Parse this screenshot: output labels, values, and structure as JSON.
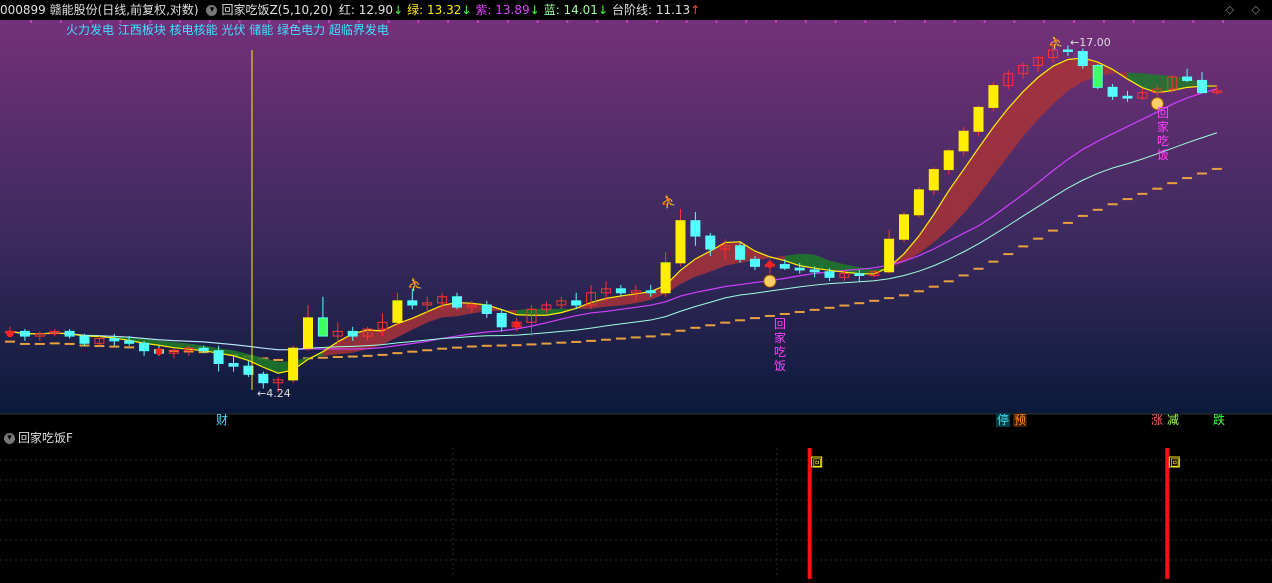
{
  "header": {
    "stock": "000899 赣能股份(日线,前复权,对数)",
    "indicator_name": "回家吃饭Z(5,10,20)",
    "red_label": "红: 12.90",
    "green_label": "绿: 13.32",
    "purple_label": "紫: 13.89",
    "blue_label": "蓝: 14.01",
    "step_label": "台阶线: 11.13",
    "arrow_down": "↓",
    "arrow_up": "↑",
    "icon_left": "chevron-left-icon",
    "icon_right": "chevron-right-icon"
  },
  "colors": {
    "red": "#ff4444",
    "green": "#4cff4c",
    "purple": "#d040ff",
    "blue": "#40e0ff",
    "yellow": "#ffee00",
    "step": "#e8a040",
    "candle_up": "#ff3030",
    "candle_down": "#54ffff"
  },
  "concepts": "火力发电 江西板块 核电核能 光伏 储能 绿色电力 超临界发电",
  "annotations": {
    "high": "17.00",
    "low": "4.24",
    "chars": [
      "回",
      "家",
      "吃",
      "饭"
    ],
    "fin": "财",
    "ting": "停",
    "yu": "预",
    "zhang": "涨",
    "jian": "减",
    "die": "跌"
  },
  "sub": {
    "title": "回家吃饭F",
    "marker": "回"
  },
  "chart_data": {
    "type": "candlestick",
    "scale": "log",
    "high_price": 17.0,
    "low_price": 4.24,
    "ma_values": {
      "红": 12.9,
      "绿": 13.32,
      "紫": 13.89,
      "蓝": 14.01,
      "台阶线": 11.13
    },
    "candles": [
      [
        5.4,
        5.5,
        5.3,
        5.4
      ],
      [
        5.4,
        5.45,
        5.2,
        5.3
      ],
      [
        5.3,
        5.4,
        5.2,
        5.35
      ],
      [
        5.35,
        5.45,
        5.3,
        5.4
      ],
      [
        5.4,
        5.45,
        5.25,
        5.3
      ],
      [
        5.3,
        5.35,
        5.1,
        5.15
      ],
      [
        5.15,
        5.3,
        5.1,
        5.25
      ],
      [
        5.25,
        5.35,
        5.1,
        5.2
      ],
      [
        5.2,
        5.3,
        5.1,
        5.15
      ],
      [
        5.15,
        5.2,
        4.9,
        5.0
      ],
      [
        5.0,
        5.1,
        4.9,
        4.95
      ],
      [
        4.95,
        5.05,
        4.85,
        5.0
      ],
      [
        5.0,
        5.1,
        4.9,
        5.05
      ],
      [
        5.05,
        5.1,
        4.95,
        5.0
      ],
      [
        5.0,
        5.1,
        4.6,
        4.75
      ],
      [
        4.75,
        4.9,
        4.6,
        4.7
      ],
      [
        4.7,
        4.8,
        4.5,
        4.55
      ],
      [
        4.55,
        4.6,
        4.3,
        4.4
      ],
      [
        4.4,
        4.5,
        4.24,
        4.45
      ],
      [
        4.45,
        5.1,
        4.4,
        5.05
      ],
      [
        5.05,
        6.0,
        5.0,
        5.7
      ],
      [
        5.7,
        6.2,
        5.5,
        5.3
      ],
      [
        5.3,
        5.6,
        5.1,
        5.4
      ],
      [
        5.4,
        5.5,
        5.2,
        5.3
      ],
      [
        5.3,
        5.5,
        5.2,
        5.45
      ],
      [
        5.45,
        5.8,
        5.3,
        5.6
      ],
      [
        5.6,
        6.3,
        5.5,
        6.1
      ],
      [
        6.1,
        6.4,
        5.9,
        6.0
      ],
      [
        6.0,
        6.2,
        5.8,
        6.05
      ],
      [
        6.05,
        6.3,
        5.9,
        6.2
      ],
      [
        6.2,
        6.3,
        5.9,
        5.95
      ],
      [
        5.95,
        6.1,
        5.8,
        6.0
      ],
      [
        6.0,
        6.1,
        5.7,
        5.8
      ],
      [
        5.8,
        5.9,
        5.4,
        5.5
      ],
      [
        5.5,
        5.7,
        5.4,
        5.6
      ],
      [
        5.6,
        6.0,
        5.3,
        5.9
      ],
      [
        5.9,
        6.1,
        5.8,
        6.0
      ],
      [
        6.0,
        6.2,
        5.9,
        6.1
      ],
      [
        6.1,
        6.3,
        5.9,
        6.0
      ],
      [
        6.0,
        6.5,
        5.9,
        6.3
      ],
      [
        6.3,
        6.6,
        6.1,
        6.4
      ],
      [
        6.4,
        6.5,
        6.2,
        6.3
      ],
      [
        6.3,
        6.5,
        6.1,
        6.35
      ],
      [
        6.35,
        6.5,
        6.2,
        6.3
      ],
      [
        6.3,
        7.4,
        6.2,
        7.1
      ],
      [
        7.1,
        8.8,
        7.0,
        8.4
      ],
      [
        8.4,
        8.7,
        7.6,
        7.9
      ],
      [
        7.9,
        8.0,
        7.3,
        7.5
      ],
      [
        7.5,
        7.8,
        7.2,
        7.6
      ],
      [
        7.6,
        7.7,
        7.1,
        7.2
      ],
      [
        7.2,
        7.3,
        6.9,
        7.0
      ],
      [
        7.0,
        7.2,
        6.8,
        7.05
      ],
      [
        7.05,
        7.2,
        6.9,
        6.95
      ],
      [
        6.95,
        7.1,
        6.8,
        6.9
      ],
      [
        6.9,
        7.0,
        6.7,
        6.85
      ],
      [
        6.85,
        6.95,
        6.6,
        6.7
      ],
      [
        6.7,
        6.9,
        6.6,
        6.8
      ],
      [
        6.8,
        6.9,
        6.6,
        6.75
      ],
      [
        6.75,
        6.9,
        6.7,
        6.85
      ],
      [
        6.85,
        8.1,
        6.8,
        7.8
      ],
      [
        7.8,
        8.7,
        7.7,
        8.6
      ],
      [
        8.6,
        9.6,
        8.5,
        9.5
      ],
      [
        9.5,
        10.4,
        9.3,
        10.3
      ],
      [
        10.3,
        11.2,
        10.1,
        11.1
      ],
      [
        11.1,
        12.2,
        10.9,
        12.0
      ],
      [
        12.0,
        13.3,
        11.8,
        13.2
      ],
      [
        13.2,
        14.6,
        13.0,
        14.4
      ],
      [
        14.4,
        15.3,
        14.2,
        15.1
      ],
      [
        15.1,
        15.8,
        14.8,
        15.6
      ],
      [
        15.6,
        16.2,
        15.2,
        16.1
      ],
      [
        16.1,
        17.0,
        15.8,
        16.6
      ],
      [
        16.6,
        16.9,
        16.2,
        16.5
      ],
      [
        16.5,
        16.7,
        15.4,
        15.6
      ],
      [
        15.6,
        15.7,
        14.2,
        14.3
      ],
      [
        14.3,
        14.5,
        13.6,
        13.8
      ],
      [
        13.8,
        14.1,
        13.5,
        13.7
      ],
      [
        13.7,
        14.2,
        13.6,
        14.0
      ],
      [
        14.0,
        14.4,
        13.8,
        14.2
      ],
      [
        14.2,
        15.0,
        14.0,
        14.9
      ],
      [
        14.9,
        15.4,
        14.6,
        14.7
      ],
      [
        14.7,
        15.2,
        14.3,
        14.0
      ],
      [
        14.0,
        14.4,
        13.9,
        14.1
      ]
    ],
    "sub_signals": [
      {
        "index": 53,
        "label": "回"
      },
      {
        "index": 77,
        "label": "回"
      }
    ]
  }
}
